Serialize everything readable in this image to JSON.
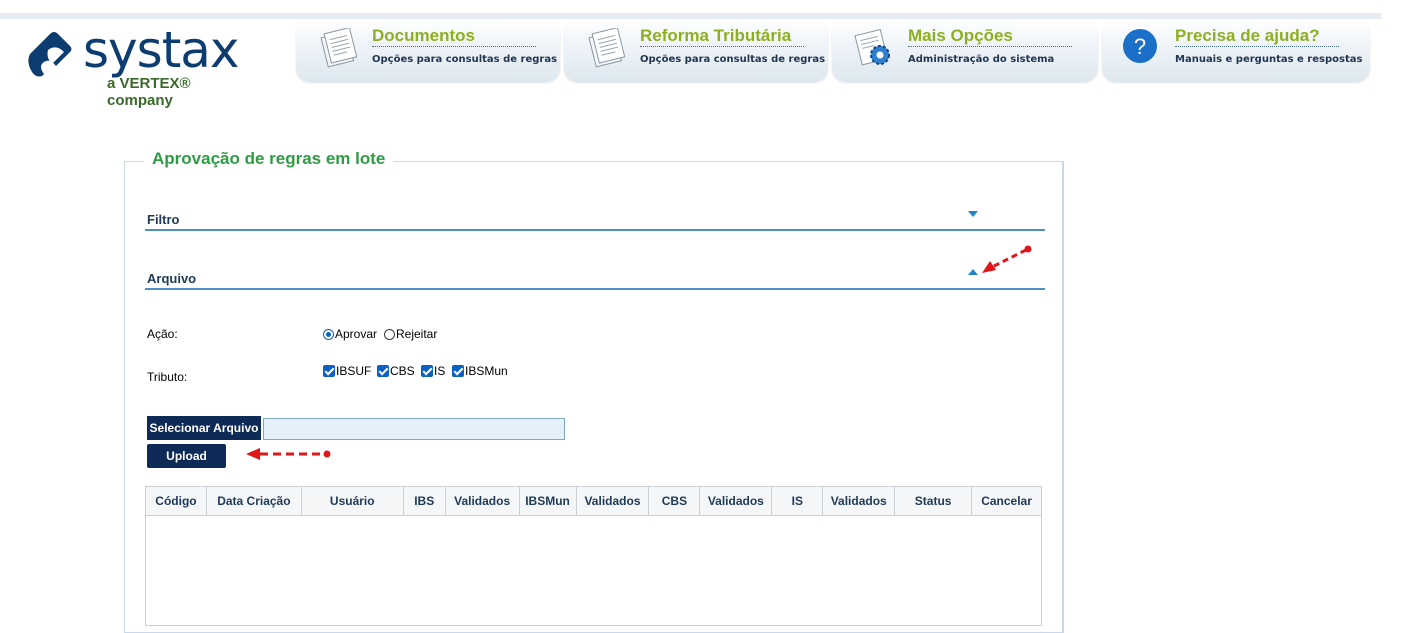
{
  "brand": {
    "name": "systax",
    "tagline": "a VERTEX® company",
    "primary_color": "#0d3c70",
    "accent_color": "#8db020"
  },
  "nav": {
    "tabs": [
      {
        "title": "Documentos",
        "subtitle": "Opções para consultas de regras",
        "icon": "documents-icon"
      },
      {
        "title": "Reforma Tributária",
        "subtitle": "Opções para consultas de regras",
        "icon": "documents-icon"
      },
      {
        "title": "Mais Opções",
        "subtitle": "Administração do sistema",
        "icon": "settings-gear-icon"
      },
      {
        "title": "Precisa de ajuda?",
        "subtitle": "Manuais e perguntas e respostas",
        "icon": "help-question-icon"
      }
    ]
  },
  "page": {
    "title": "Aprovação de regras em lote",
    "title_color": "#2e9c45"
  },
  "sections": {
    "filtro": {
      "label": "Filtro",
      "expanded": false
    },
    "arquivo": {
      "label": "Arquivo",
      "expanded": true
    }
  },
  "form": {
    "acao": {
      "label": "Ação:",
      "options": [
        {
          "label": "Aprovar",
          "selected": true
        },
        {
          "label": "Rejeitar",
          "selected": false
        }
      ]
    },
    "tributo": {
      "label": "Tributo:",
      "options": [
        {
          "label": "IBSUF",
          "checked": true
        },
        {
          "label": "CBS",
          "checked": true
        },
        {
          "label": "IS",
          "checked": true
        },
        {
          "label": "IBSMun",
          "checked": true
        }
      ]
    },
    "select_file_label": "Selecionar Arquivo",
    "file_value": "",
    "upload_label": "Upload"
  },
  "table": {
    "columns": [
      "Código",
      "Data Criação",
      "Usuário",
      "IBS",
      "Validados",
      "IBSMun",
      "Validados",
      "CBS",
      "Validados",
      "IS",
      "Validados",
      "Status",
      "Cancelar"
    ],
    "rows": []
  },
  "annotations": {
    "arrow_color": "#e0161b"
  }
}
